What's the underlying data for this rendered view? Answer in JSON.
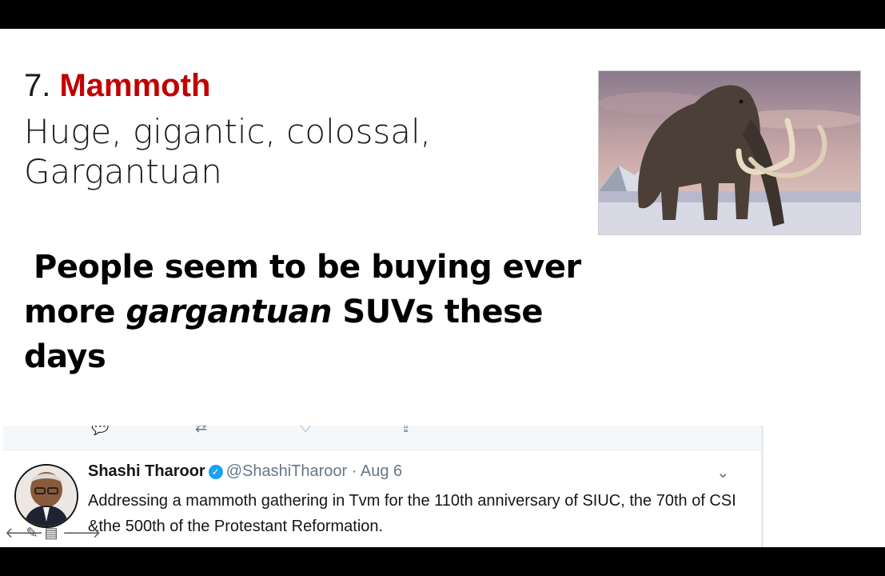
{
  "slide": {
    "number": "7.",
    "word": "Mammoth",
    "synonyms_line1": "Huge, gigantic, colossal,",
    "synonyms_line2": "Gargantuan",
    "example_line1": "People seem to be buying ever",
    "example_pre": "more ",
    "example_emph": "gargantuan",
    "example_post": " SUVs these days"
  },
  "tweet": {
    "author": "Shashi Tharoor",
    "handle": "@ShashiTharoor",
    "separator": "·",
    "date": "Aug 6",
    "text": "Addressing a mammoth gathering in Tvm for the 110th anniversary of SIUC, the 70th of CSI &the 500th of the Protestant Reformation.",
    "icons": [
      "reply-icon",
      "retweet-icon",
      "like-icon",
      "share-icon",
      "verified-icon",
      "chevron-down-icon"
    ]
  },
  "colors": {
    "accent_red": "#c00000",
    "twitter_blue": "#1da1f2",
    "muted_gray": "#657786"
  }
}
